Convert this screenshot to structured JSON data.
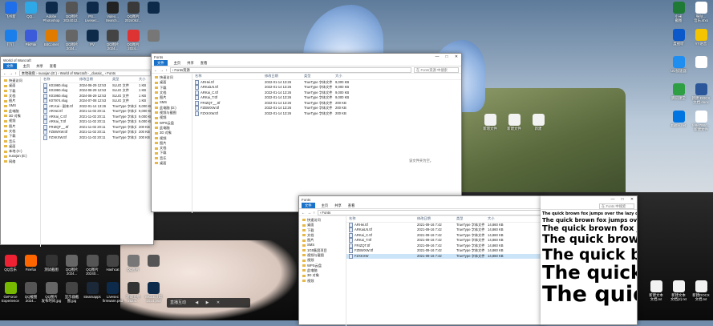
{
  "desktop": {
    "left_icons": [
      {
        "label": "飞书新",
        "color": "#1f6feb"
      },
      {
        "label": "QQ...",
        "color": "#2ea8e6"
      },
      {
        "label": "Adobe\nPhotoshop",
        "color": "#0d2a4a"
      },
      {
        "label": "QQ图片\n2024012...",
        "color": "#555"
      },
      {
        "label": "PS...\nLivesec...",
        "color": "#0d2a4a"
      },
      {
        "label": "Video...\nSearch...",
        "color": "#222"
      },
      {
        "label": "QQ图片\n2024062...",
        "color": "#3a3a3a"
      },
      {
        "label": "",
        "color": "#0d2a4a"
      },
      {
        "label": "钉钉",
        "color": "#1a7fea"
      },
      {
        "label": "PikPak",
        "color": "#3b5bdb"
      },
      {
        "label": "BitComet",
        "color": "#e07b00"
      },
      {
        "label": "QQ图片\n2024...",
        "color": "#666"
      },
      {
        "label": "PV",
        "color": "#0d2a4a"
      },
      {
        "label": "QQ图片\n2024...",
        "color": "#444"
      },
      {
        "label": "QQ图片\n2024...",
        "color": "#d33"
      },
      {
        "label": "",
        "color": "#777"
      }
    ],
    "bottom_icons": [
      {
        "label": "QQ音乐",
        "color": "#e23"
      },
      {
        "label": "Firefox",
        "color": "#f60"
      },
      {
        "label": "测试截图",
        "color": "#333"
      },
      {
        "label": "QQ图片\n2024...",
        "color": "#666"
      },
      {
        "label": "QQ图片\n20240...",
        "color": "#555"
      },
      {
        "label": "Hashcat",
        "color": "#444"
      },
      {
        "label": "QQ图片",
        "color": "#777"
      },
      {
        "label": "",
        "color": "#555"
      },
      {
        "label": "GeForce\nExperience",
        "color": "#76b900"
      },
      {
        "label": "QQ截图\n2024...",
        "color": "#555"
      },
      {
        "label": "QQ图片\n发布时间.jpg",
        "color": "#666"
      },
      {
        "label": "显示器截图.jpg",
        "color": "#444"
      },
      {
        "label": "steamapps",
        "color": "#1b2838"
      },
      {
        "label": "Livesec\nfirmware.psd",
        "color": "#0d2a4a"
      },
      {
        "label": "游戏立绘\n2024...",
        "color": "#333"
      },
      {
        "label": "WCLE获取\n2024.psd",
        "color": "#0d2a4a"
      }
    ],
    "right_icons": [
      {
        "label": "小米\n截图",
        "color": "#1e7a35"
      },
      {
        "label": "咪咕...\n音乐.sfxs",
        "color": "#fff"
      },
      {
        "label": "度视听",
        "color": "#0a58ca"
      },
      {
        "label": "YY语音",
        "color": "#f5c400"
      },
      {
        "label": "UU加速器",
        "color": "#1f8ef1"
      },
      {
        "label": "",
        "color": "#fff"
      },
      {
        "label": "腾讯课堂",
        "color": "#2ea043"
      },
      {
        "label": "新建 DOCX\n文档.docx",
        "color": "#2b579a"
      },
      {
        "label": "Battle.net",
        "color": "#0074e0"
      },
      {
        "label": "fe8e798c...\n新建文件",
        "color": "#fff"
      }
    ],
    "bottom_right_icons": [
      {
        "label": "新建文本\n文档.txt"
      },
      {
        "label": "新建文本\n文档(2).txt"
      },
      {
        "label": "新建DOCX\n文档.txt"
      }
    ],
    "mid_right_icons": [
      {
        "label": "新增文件"
      },
      {
        "label": "新建文件"
      },
      {
        "label": "新建"
      }
    ],
    "taskbar_popup": "直播互动"
  },
  "explorer_back": {
    "title": "World of Warcraft",
    "tabs": [
      "文件",
      "主页",
      "共享",
      "查看"
    ],
    "address": "本地磁盘 › nuoxjan (E:) › World of Warcraft › _classic_ › Fonts",
    "nav": [
      "快速访问",
      "桌面",
      "下载",
      "文档",
      "图片",
      "SMS",
      "此电脑",
      "3D 对象",
      "视频",
      "图片",
      "文档",
      "下载",
      "音乐",
      "桌面",
      "本地 (C:)",
      "nuoxjan (E:)",
      "网络"
    ],
    "header": [
      "名称",
      "修改日期",
      "类型",
      "大小"
    ],
    "rows": [
      {
        "name": "K01960.slug",
        "date": "2024-06-29 12:53",
        "type": "SLUG 文件",
        "size": "1 KB"
      },
      {
        "name": "K01960.slug",
        "date": "2024-06-29 12:53",
        "type": "SLUG 文件",
        "size": "1 KB"
      },
      {
        "name": "K01960.slug",
        "date": "2024-06-29 12:53",
        "type": "SLUG 文件",
        "size": "1 KB"
      },
      {
        "name": "K07974.slug",
        "date": "2024-07-08 12:53",
        "type": "SLUG 文件",
        "size": "1 KB"
      },
      {
        "name": "AR.Kai - 副本.ttf",
        "date": "2022-01-14 13:26",
        "type": "TrueType 字体文件",
        "size": "9,000 KB"
      },
      {
        "name": "ARHei.ttf",
        "date": "2021-11-02 20:11",
        "type": "TrueType 字体文件",
        "size": "9,000 KB"
      },
      {
        "name": "ARKai_C.ttf",
        "date": "2021-11-02 20:11",
        "type": "TrueType 字体文件",
        "size": "9,000 KB"
      },
      {
        "name": "ARKai_T.ttf",
        "date": "2021-11-02 20:11",
        "type": "TrueType 字体文件",
        "size": "9,000 KB"
      },
      {
        "name": "FRIZQT__.ttf",
        "date": "2021-11-02 20:11",
        "type": "TrueType 字体文件",
        "size": "200 KB"
      },
      {
        "name": "FZBWXW.ttf",
        "date": "2021-11-02 20:11",
        "type": "TrueType 字体文件",
        "size": "200 KB"
      },
      {
        "name": "FZXKXW.ttf",
        "date": "2021-11-02 20:11",
        "type": "TrueType 字体文件",
        "size": "200 KB"
      }
    ]
  },
  "explorer_mid": {
    "title": "Fonts",
    "tabs": [
      "文件",
      "主页",
      "共享",
      "查看"
    ],
    "address": "› Fonts资源",
    "search": "在 Fonts资源 中搜索",
    "nav": [
      "快速访问",
      "桌面",
      "下载",
      "文档",
      "图片",
      "SMS",
      "此电脑 (D:)",
      "视频与截图",
      "视频",
      "WPS云盘",
      "此电脑",
      "3D 对象",
      "视频",
      "图片",
      "文档",
      "下载",
      "音乐",
      "桌面"
    ],
    "header": [
      "名称",
      "修改日期",
      "类型",
      "大小"
    ],
    "rows": [
      {
        "name": "ARHei.ttf",
        "date": "2022-01-14 13:26",
        "type": "TrueType 字体文件",
        "size": "9,000 KB"
      },
      {
        "name": "ARKaiLN.ttf",
        "date": "2022-01-14 13:26",
        "type": "TrueType 字体文件",
        "size": "9,000 KB"
      },
      {
        "name": "ARKai_C.ttf",
        "date": "2022-01-14 13:26",
        "type": "TrueType 字体文件",
        "size": "9,000 KB"
      },
      {
        "name": "ARKai_T.ttf",
        "date": "2022-01-14 13:26",
        "type": "TrueType 字体文件",
        "size": "9,000 KB"
      },
      {
        "name": "FRIZQT__.ttf",
        "date": "2022-01-14 13:26",
        "type": "TrueType 字体文件",
        "size": "200 KB"
      },
      {
        "name": "FZBWXW.ttf",
        "date": "2022-01-14 13:26",
        "type": "TrueType 字体文件",
        "size": "200 KB"
      },
      {
        "name": "FZXKXW.ttf",
        "date": "2022-01-14 13:26",
        "type": "TrueType 字体文件",
        "size": "200 KB"
      }
    ],
    "empty": "该文件夹为空。"
  },
  "explorer_front": {
    "title": "Fonts",
    "tabs": [
      "文件",
      "主页",
      "共享",
      "查看"
    ],
    "address": "› Fonts",
    "search": "在 Fonts 中搜索",
    "nav": [
      "快速访问",
      "桌面",
      "下载",
      "文档",
      "图片",
      "SMS",
      "1G5集团项目",
      "视频与截图",
      "视频",
      "WPS云盘",
      "此电脑",
      "3D 对象",
      "视频"
    ],
    "header": [
      "名称",
      "修改日期",
      "类型",
      "大小"
    ],
    "rows": [
      {
        "name": "ARHei.ttf",
        "date": "2021-09-16 7:42",
        "type": "TrueType 字体文件",
        "size": "14,860 KB"
      },
      {
        "name": "ARKaiLN.ttf",
        "date": "2021-09-16 7:42",
        "type": "TrueType 字体文件",
        "size": "14,860 KB"
      },
      {
        "name": "ARKai_C.ttf",
        "date": "2021-09-16 7:42",
        "type": "TrueType 字体文件",
        "size": "14,860 KB"
      },
      {
        "name": "ARKai_T.ttf",
        "date": "2021-09-16 7:42",
        "type": "TrueType 字体文件",
        "size": "14,860 KB"
      },
      {
        "name": "FRIZQT.ttf",
        "date": "2021-09-16 7:42",
        "type": "TrueType 字体文件",
        "size": "14,860 KB"
      },
      {
        "name": "FZBWXW.ttf",
        "date": "2021-09-16 7:42",
        "type": "TrueType 字体文件",
        "size": "14,860 KB"
      },
      {
        "name": "FZXKXW",
        "date": "2021-09-16 7:42",
        "type": "TrueType 字体文件",
        "size": "14,860 KB"
      }
    ]
  },
  "font_preview": {
    "title": "",
    "search": "在 Fonts 中搜索",
    "sizes": [
      "12",
      "18",
      "24",
      "36",
      "48",
      "60",
      "72"
    ],
    "sample": "The quick brown fox jumps over the lazy dog."
  }
}
